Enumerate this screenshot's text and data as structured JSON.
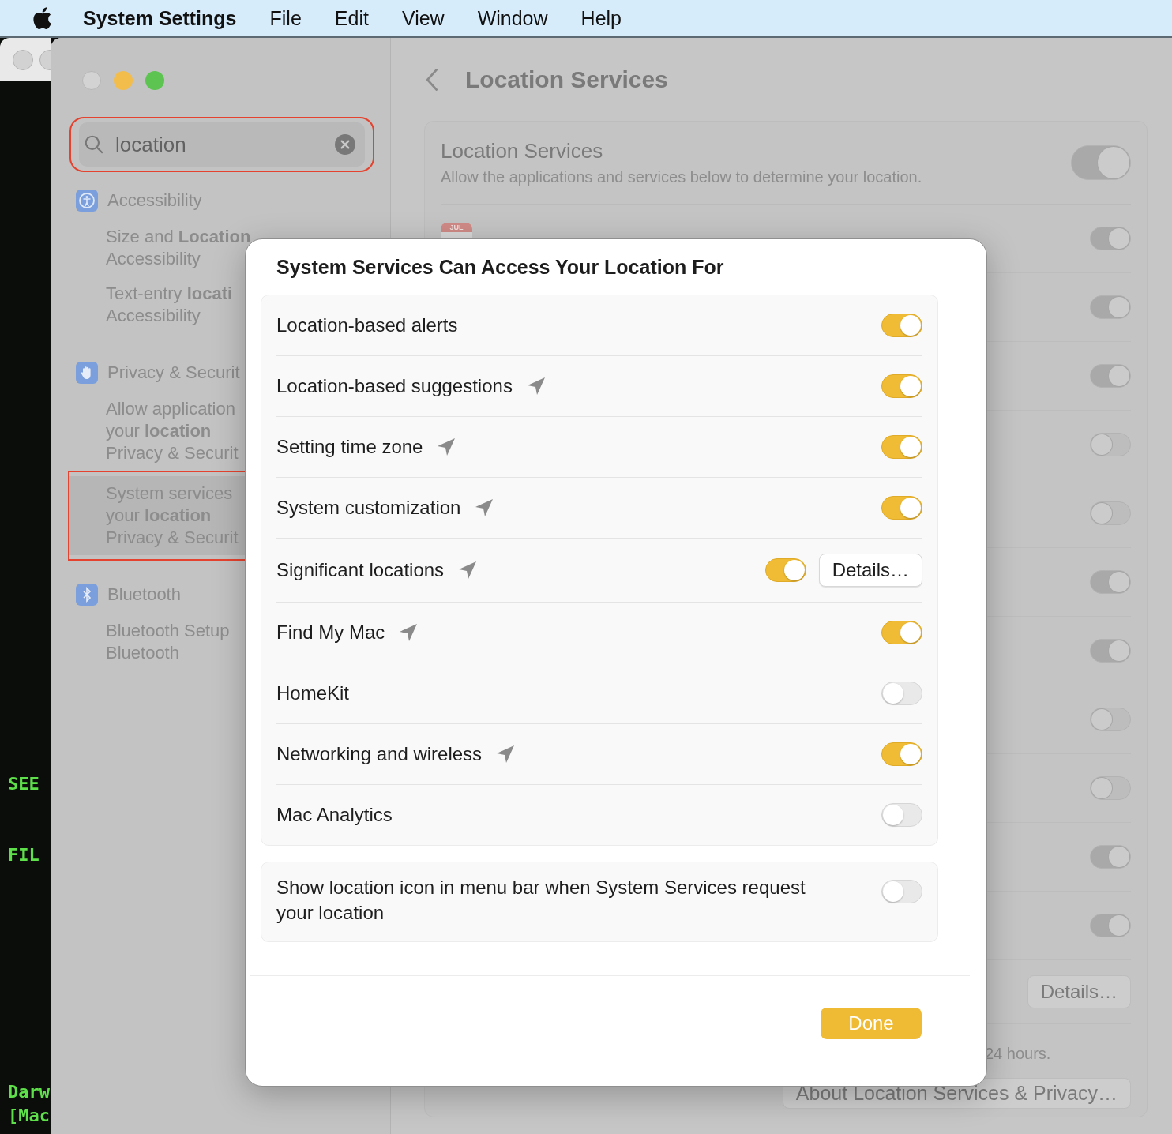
{
  "menu_bar": {
    "app": "System Settings",
    "menus": [
      "File",
      "Edit",
      "View",
      "Window",
      "Help"
    ]
  },
  "terminal": {
    "lines": [
      "SEE",
      "FIL",
      "Darw",
      "[Mac"
    ]
  },
  "sidebar": {
    "search": {
      "value": "location",
      "annotated": true
    },
    "groups": [
      {
        "kind": "accessibility",
        "title": "Accessibility",
        "results": [
          {
            "lines": [
              "Size and **Location**",
              "Accessibility"
            ],
            "selected": false,
            "annotated": false
          },
          {
            "lines": [
              "Text-entry **locati**",
              "Accessibility"
            ],
            "selected": false,
            "annotated": false
          }
        ]
      },
      {
        "kind": "privacy",
        "title": "Privacy & Securit",
        "results": [
          {
            "lines": [
              "Allow application",
              "your **location**",
              "Privacy & Securit"
            ],
            "selected": false,
            "annotated": false
          },
          {
            "lines": [
              "System services",
              "your **location**",
              "Privacy & Securit"
            ],
            "selected": true,
            "annotated": true
          }
        ]
      },
      {
        "kind": "bluetooth",
        "title": "Bluetooth",
        "results": [
          {
            "lines": [
              "Bluetooth Setup",
              "Bluetooth"
            ],
            "selected": false,
            "annotated": false
          }
        ]
      }
    ]
  },
  "main": {
    "title": "Location Services",
    "master": {
      "title": "Location Services",
      "description": "Allow the applications and services below to determine your location.",
      "on": true
    },
    "rows": [
      {
        "kind": "calendar",
        "badge": "JUL",
        "on": true
      },
      {
        "kind": "hidden",
        "on": true
      },
      {
        "kind": "hidden",
        "on": true
      },
      {
        "kind": "hidden",
        "on": false
      },
      {
        "kind": "hidden",
        "on": false
      },
      {
        "kind": "hidden",
        "on": true
      },
      {
        "kind": "hidden",
        "on": true
      },
      {
        "kind": "hidden",
        "on": false
      },
      {
        "kind": "hidden",
        "on": false
      },
      {
        "kind": "hidden",
        "on": true
      },
      {
        "kind": "hidden",
        "on": true
      }
    ],
    "details_button": "Details…",
    "note": "24 hours.",
    "about_button": "About Location Services & Privacy…"
  },
  "sheet": {
    "title": "System Services Can Access Your Location For",
    "services": [
      {
        "label": "Location-based alerts",
        "on": true,
        "location_arrow": false
      },
      {
        "label": "Location-based suggestions",
        "on": true,
        "location_arrow": true
      },
      {
        "label": "Setting time zone",
        "on": true,
        "location_arrow": true
      },
      {
        "label": "System customization",
        "on": true,
        "location_arrow": true
      },
      {
        "label": "Significant locations",
        "on": true,
        "location_arrow": true,
        "button": "Details…"
      },
      {
        "label": "Find My Mac",
        "on": true,
        "location_arrow": true
      },
      {
        "label": "HomeKit",
        "on": false,
        "location_arrow": false
      },
      {
        "label": "Networking and wireless",
        "on": true,
        "location_arrow": true
      },
      {
        "label": "Mac Analytics",
        "on": false,
        "location_arrow": false
      }
    ],
    "menu_bar_icon": {
      "label": "Show location icon in menu bar when System Services request your location",
      "on": false
    },
    "done": "Done"
  }
}
